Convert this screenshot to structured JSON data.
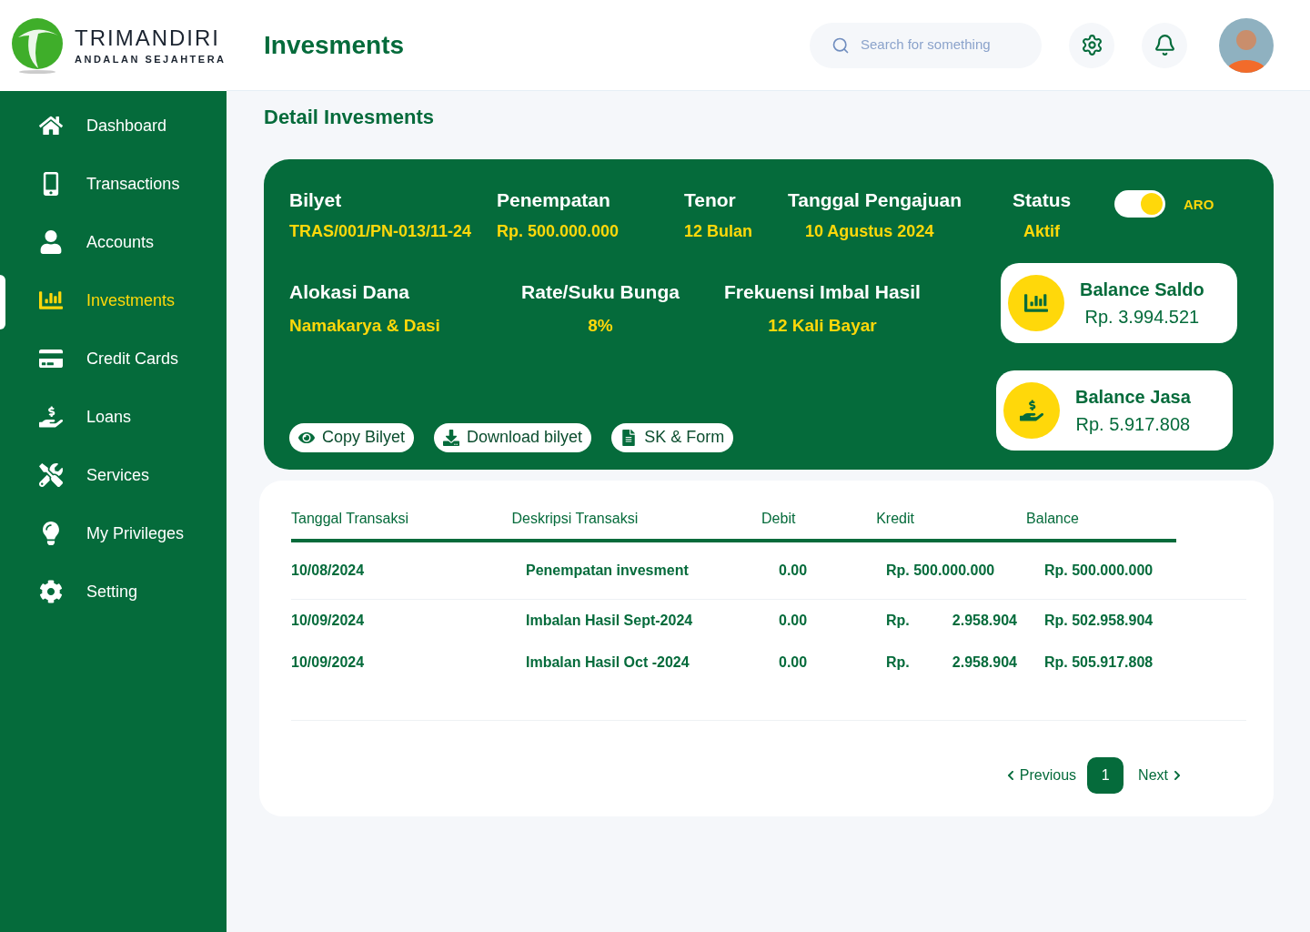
{
  "brand": {
    "name": "TRIMANDIRI",
    "tagline": "ANDALAN SEJAHTERA"
  },
  "sidebar": {
    "items": [
      {
        "label": "Dashboard",
        "kind": "home",
        "selected": false
      },
      {
        "label": "Transactions",
        "kind": "transfer",
        "selected": false
      },
      {
        "label": "Accounts",
        "kind": "user",
        "selected": false
      },
      {
        "label": "Investments",
        "kind": "invest",
        "selected": true
      },
      {
        "label": "Credit Cards",
        "kind": "card",
        "selected": false
      },
      {
        "label": "Loans",
        "kind": "loan",
        "selected": false
      },
      {
        "label": "Services",
        "kind": "tools",
        "selected": false
      },
      {
        "label": "My Privileges",
        "kind": "idea",
        "selected": false
      },
      {
        "label": "Setting",
        "kind": "gear",
        "selected": false
      }
    ]
  },
  "header": {
    "title": "Invesments",
    "search": {
      "placeholder": "Search for something"
    }
  },
  "page_title": "Detail Invesments",
  "detail": {
    "row_1": [
      {
        "label": "Bilyet",
        "value": "TRAS/001/PN-013/11-24"
      },
      {
        "label": "Penempatan",
        "value": "Rp. 500.000.000"
      },
      {
        "label": "Tenor",
        "value": "12 Bulan"
      },
      {
        "label": "Tanggal Pengajuan",
        "value": "10 Agustus 2024"
      },
      {
        "label": "Status",
        "value": "Aktif"
      }
    ],
    "aro": {
      "label": "ARO",
      "on": true
    },
    "row_2": [
      {
        "label": "Alokasi Dana",
        "value": "Namakarya & Dasi"
      },
      {
        "label": "Rate/Suku Bunga",
        "value": "8%"
      },
      {
        "label": "Frekuensi Imbal Hasil",
        "value": "12 Kali Bayar"
      }
    ],
    "buttons": [
      {
        "label": "Copy Bilyet",
        "kind": "eye"
      },
      {
        "label": "Download bilyet",
        "kind": "download"
      },
      {
        "label": "SK & Form",
        "kind": "form"
      }
    ],
    "balances": [
      {
        "label": "Balance Saldo",
        "value": "Rp. 3.994.521",
        "kind": "chart"
      },
      {
        "label": "Balance Jasa",
        "value": "Rp. 5.917.808",
        "kind": "money"
      }
    ]
  },
  "table": {
    "columns": [
      "Tanggal Transaksi",
      "Deskripsi Transaksi",
      "Debit",
      "Kredit",
      "Balance"
    ],
    "rows": [
      {
        "date": "10/08/2024",
        "description": "Penempatan invesment",
        "debit": "0.00",
        "kredit": [
          "Rp. 500.000.000"
        ],
        "balance": "Rp. 500.000.000"
      },
      {
        "date": "10/09/2024",
        "description": "Imbalan Hasil Sept-2024",
        "debit": "0.00",
        "kredit": [
          "Rp.",
          "2.958.904"
        ],
        "balance": "Rp. 502.958.904"
      },
      {
        "date": "10/09/2024",
        "description": "Imbalan Hasil Oct -2024",
        "debit": "0.00",
        "kredit": [
          "Rp.",
          "2.958.904"
        ],
        "balance": "Rp. 505.917.808"
      }
    ]
  },
  "pagination": {
    "previous": "Previous",
    "pages": [
      {
        "label": "1",
        "selected": true
      }
    ],
    "next": "Next"
  }
}
